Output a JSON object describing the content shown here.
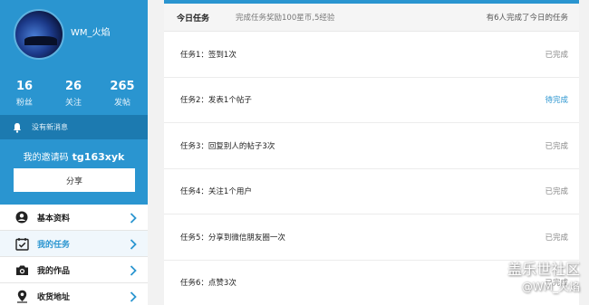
{
  "profile": {
    "username": "WM_火焰",
    "stats": [
      {
        "value": "16",
        "label": "粉丝"
      },
      {
        "value": "26",
        "label": "关注"
      },
      {
        "value": "265",
        "label": "发帖"
      }
    ]
  },
  "notice": {
    "text": "没有新消息",
    "icon": "bell-icon"
  },
  "invite": {
    "prefix": "我的邀请码",
    "code": "tg163xyk"
  },
  "share_label": "分享",
  "menu": [
    {
      "label": "基本资料",
      "icon": "user-icon",
      "active": false
    },
    {
      "label": "我的任务",
      "icon": "calendar-check-icon",
      "active": true
    },
    {
      "label": "我的作品",
      "icon": "camera-icon",
      "active": false
    },
    {
      "label": "收货地址",
      "icon": "location-pin-icon",
      "active": false
    }
  ],
  "main": {
    "title": "今日任务",
    "reward": "完成任务奖励100星币,5经验",
    "done_count": "有6人完成了今日的任务",
    "tasks": [
      {
        "name": "任务1：签到1次",
        "status": "已完成"
      },
      {
        "name": "任务2：发表1个帖子",
        "status": "待完成"
      },
      {
        "name": "任务3：回复别人的帖子3次",
        "status": "已完成"
      },
      {
        "name": "任务4：关注1个用户",
        "status": "已完成"
      },
      {
        "name": "任务5：分享到微信朋友圈一次",
        "status": "已完成"
      },
      {
        "name": "任务6：点赞3次",
        "status": "已完成"
      }
    ]
  },
  "watermark": {
    "line1": "盖乐世社区",
    "line2": "@WM_火焰"
  },
  "colors": {
    "accent": "#2a95d0",
    "notice_bg": "#1c7ab0",
    "pending": "#2a95d0"
  }
}
